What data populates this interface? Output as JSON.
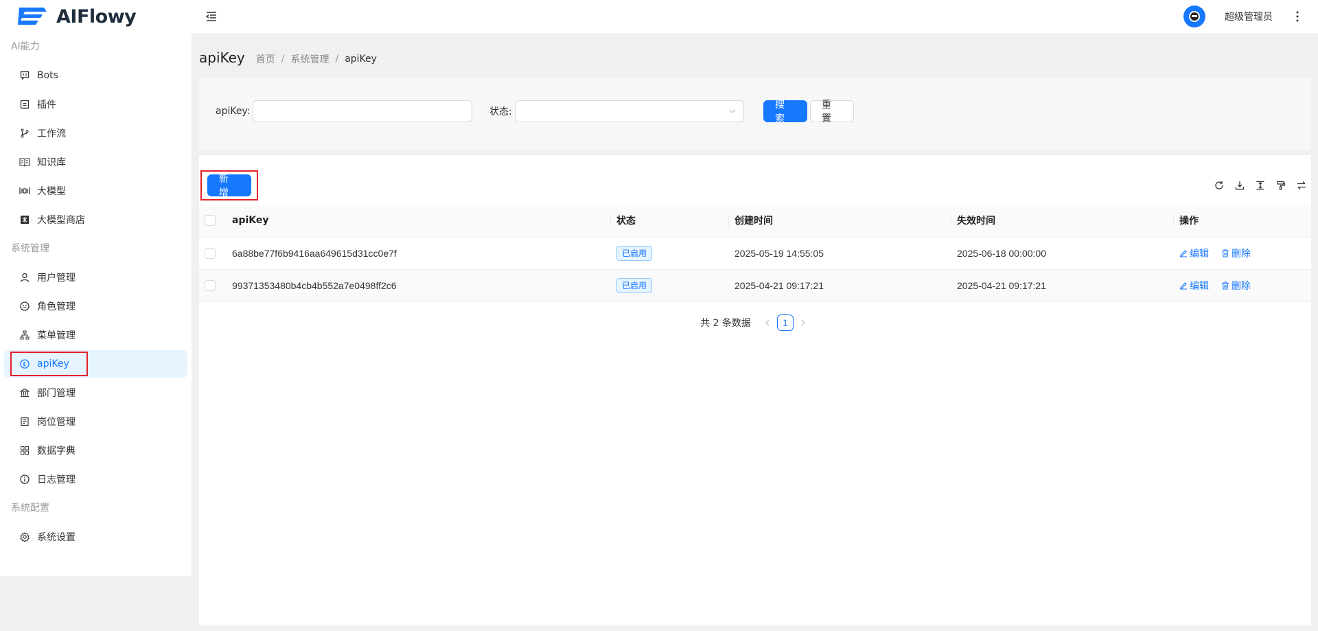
{
  "app": {
    "name": "AIFlowy"
  },
  "header": {
    "user_name": "超级管理员"
  },
  "sidebar": {
    "groups": [
      {
        "title": "AI能力",
        "items": [
          {
            "label": "Bots",
            "icon": "bot-icon"
          },
          {
            "label": "插件",
            "icon": "plugin-icon"
          },
          {
            "label": "工作流",
            "icon": "workflow-icon"
          },
          {
            "label": "知识库",
            "icon": "book-icon"
          },
          {
            "label": "大模型",
            "icon": "model-icon"
          },
          {
            "label": "大模型商店",
            "icon": "store-icon"
          }
        ]
      },
      {
        "title": "系统管理",
        "items": [
          {
            "label": "用户管理",
            "icon": "user-icon"
          },
          {
            "label": "角色管理",
            "icon": "role-icon"
          },
          {
            "label": "菜单管理",
            "icon": "menu-tree-icon"
          },
          {
            "label": "apiKey",
            "icon": "key-icon",
            "active": true
          },
          {
            "label": "部门管理",
            "icon": "bank-icon"
          },
          {
            "label": "岗位管理",
            "icon": "post-icon"
          },
          {
            "label": "数据字典",
            "icon": "grid-icon"
          },
          {
            "label": "日志管理",
            "icon": "info-icon"
          }
        ]
      },
      {
        "title": "系统配置",
        "items": [
          {
            "label": "系统设置",
            "icon": "gear-icon"
          }
        ]
      }
    ]
  },
  "page": {
    "title": "apiKey",
    "breadcrumb": [
      "首页",
      "系统管理",
      "apiKey"
    ]
  },
  "search": {
    "apikey_label": "apiKey:",
    "apikey_value": "",
    "status_label": "状态:",
    "status_value": "",
    "search_button": "搜 索",
    "reset_button": "重 置"
  },
  "toolbar": {
    "add_button": "新 增"
  },
  "table": {
    "columns": [
      "apiKey",
      "状态",
      "创建时间",
      "失效时间",
      "操作"
    ],
    "rows": [
      {
        "apikey": "6a88be77f6b9416aa649615d31cc0e7f",
        "status": "已启用",
        "created": "2025-05-19 14:55:05",
        "expires": "2025-06-18 00:00:00"
      },
      {
        "apikey": "99371353480b4cb4b552a7e0498ff2c6",
        "status": "已启用",
        "created": "2025-04-21 09:17:21",
        "expires": "2025-04-21 09:17:21"
      }
    ],
    "actions": {
      "edit": "编辑",
      "delete": "删除"
    }
  },
  "pagination": {
    "total_text": "共 2 条数据",
    "current_page": "1"
  }
}
